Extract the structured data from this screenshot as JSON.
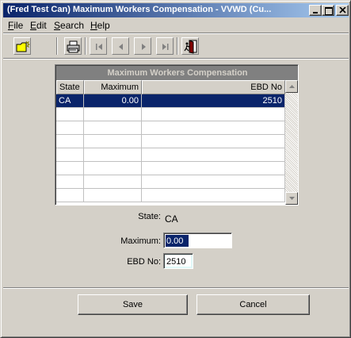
{
  "window": {
    "title": "(Fred Test Can) Maximum Workers Compensation - VVWD (Cu..."
  },
  "menu": {
    "items": [
      {
        "label": "File",
        "hotkey": "F",
        "rest": "ile"
      },
      {
        "label": "Edit",
        "hotkey": "E",
        "rest": "dit"
      },
      {
        "label": "Search",
        "hotkey": "S",
        "rest": "earch"
      },
      {
        "label": "Help",
        "hotkey": "H",
        "rest": "elp"
      }
    ]
  },
  "toolbar": {
    "icons": [
      "new-folder-icon",
      "print-icon",
      "first-record-icon",
      "previous-record-icon",
      "next-record-icon",
      "last-record-icon",
      "exit-door-icon"
    ]
  },
  "grid": {
    "caption": "Maximum Workers Compensation",
    "columns": [
      "State",
      "Maximum",
      "EBD No"
    ],
    "rows": [
      {
        "state": "CA",
        "maximum": "0.00",
        "ebd_no": "2510"
      }
    ]
  },
  "form": {
    "state_label": "State:",
    "state_value": "CA",
    "maximum_label": "Maximum:",
    "maximum_value": "0.00",
    "ebd_label": "EBD No:",
    "ebd_value": "2510"
  },
  "buttons": {
    "save": "Save",
    "cancel": "Cancel"
  },
  "colors": {
    "title_bar_start": "#0a246a",
    "title_bar_end": "#a6caf0",
    "selection": "#0a246a",
    "face": "#d4d0c8"
  }
}
